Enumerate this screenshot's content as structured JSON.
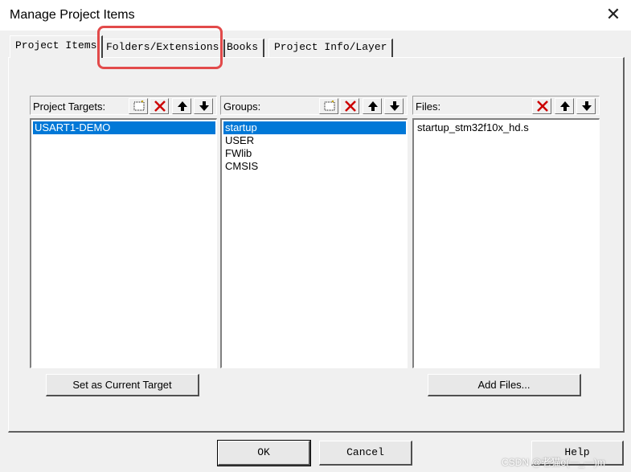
{
  "window": {
    "title": "Manage Project Items",
    "close_glyph": "✕"
  },
  "tabs": [
    {
      "label": "Project Items",
      "active": true
    },
    {
      "label": "Folders/Extensions",
      "active": false,
      "highlighted": true
    },
    {
      "label": "Books",
      "active": false
    },
    {
      "label": "Project Info/Layer",
      "active": false
    }
  ],
  "targets": {
    "label": "Project Targets:",
    "toolbar": [
      "new-icon",
      "delete-icon",
      "move-up-icon",
      "move-down-icon"
    ],
    "items": [
      {
        "label": "USART1-DEMO",
        "selected": true
      }
    ],
    "button_label": "Set as Current Target"
  },
  "groups": {
    "label": "Groups:",
    "toolbar": [
      "new-icon",
      "delete-icon",
      "move-up-icon",
      "move-down-icon"
    ],
    "items": [
      {
        "label": "startup",
        "selected": true
      },
      {
        "label": "USER",
        "selected": false
      },
      {
        "label": "FWlib",
        "selected": false
      },
      {
        "label": "CMSIS",
        "selected": false
      }
    ]
  },
  "files": {
    "label": "Files:",
    "toolbar": [
      "delete-icon",
      "move-up-icon",
      "move-down-icon"
    ],
    "items": [
      {
        "label": "startup_stm32f10x_hd.s",
        "selected": false
      }
    ],
    "button_label": "Add Files..."
  },
  "footer": {
    "ok_label": "OK",
    "cancel_label": "Cancel",
    "help_label": "Help"
  },
  "watermark": "CSDN @老猫o(—_—)m",
  "colors": {
    "selection": "#0078d7",
    "highlight_box": "#e24a4a",
    "delete_red": "#cc0000"
  }
}
